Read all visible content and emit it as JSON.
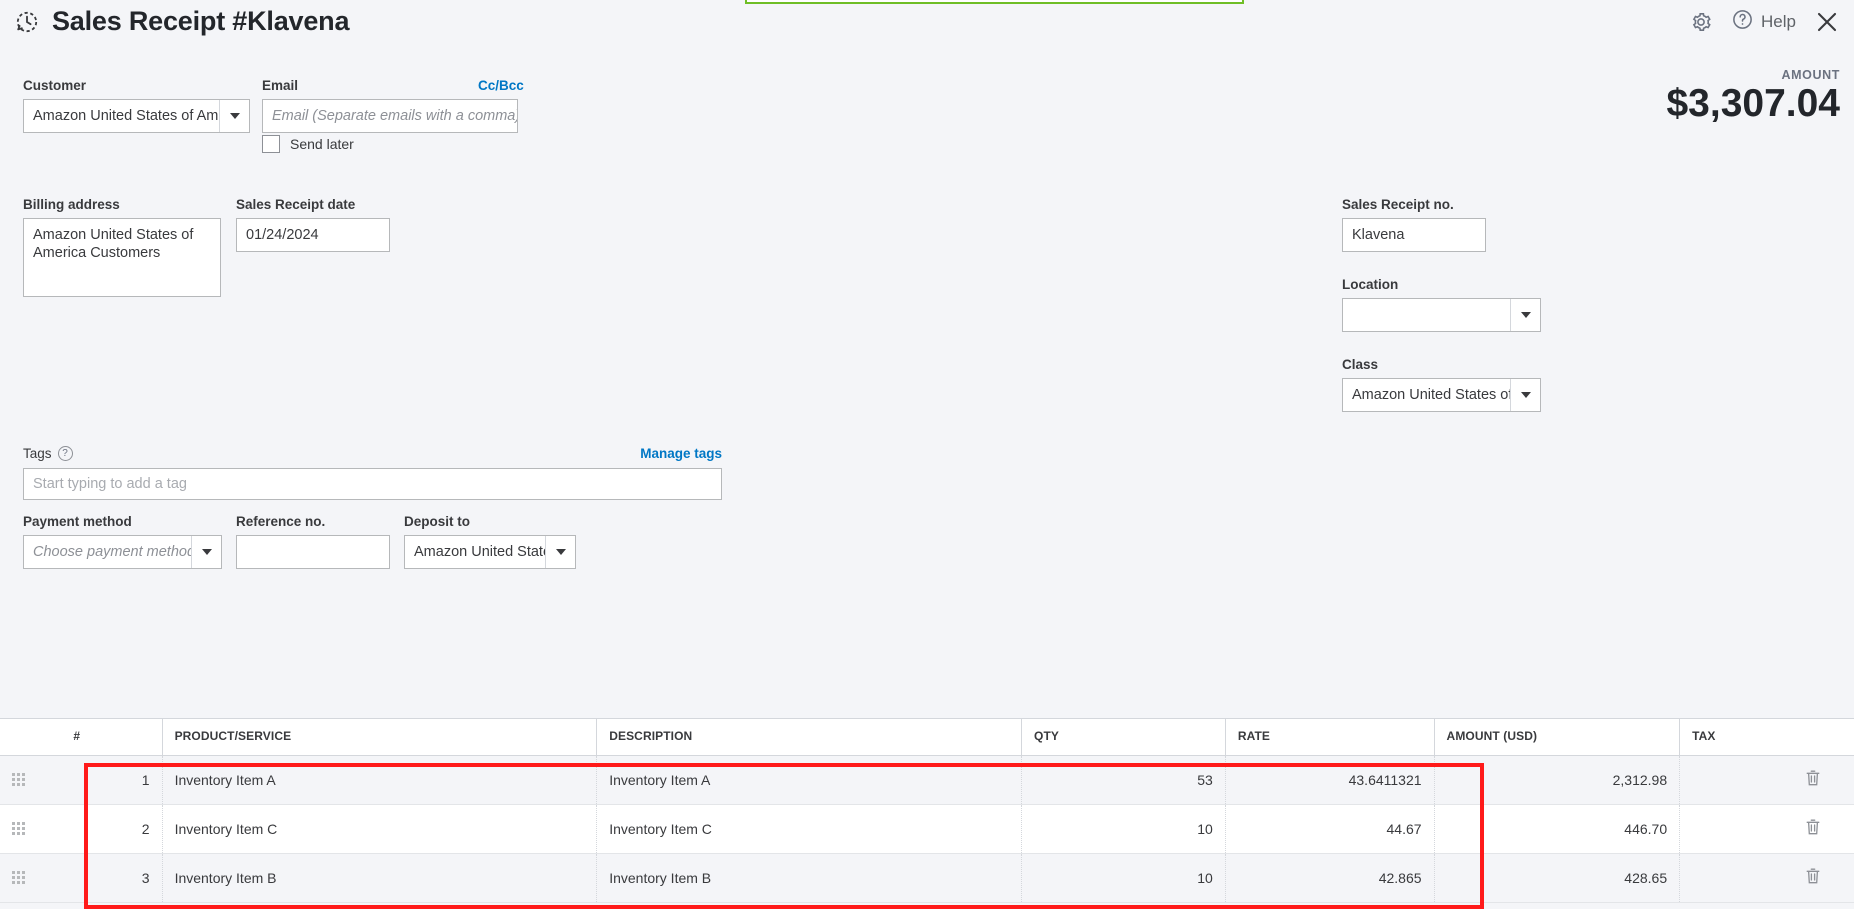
{
  "header": {
    "title": "Sales Receipt #Klavena",
    "recurring_icon": "recurring-clock-icon",
    "gear_icon": "gear-icon",
    "help_icon": "help-circle-icon",
    "help_label": "Help",
    "close_icon": "close-icon"
  },
  "amount": {
    "label": "AMOUNT",
    "value": "$3,307.04"
  },
  "form": {
    "customer": {
      "label": "Customer",
      "value": "Amazon United States of America"
    },
    "email": {
      "label": "Email",
      "cc_bcc": "Cc/Bcc",
      "placeholder": "Email (Separate emails with a comma)",
      "value": ""
    },
    "send_later": {
      "label": "Send later",
      "checked": false
    },
    "billing_address": {
      "label": "Billing address",
      "value": "Amazon United States of America Customers"
    },
    "receipt_date": {
      "label": "Sales Receipt date",
      "value": "01/24/2024"
    },
    "receipt_no": {
      "label": "Sales Receipt no.",
      "value": "Klavena"
    },
    "location": {
      "label": "Location",
      "value": ""
    },
    "class": {
      "label": "Class",
      "value": "Amazon United States of Am"
    },
    "tags": {
      "label": "Tags",
      "help_icon": "question-mark-icon",
      "manage_link": "Manage tags",
      "placeholder": "Start typing to add a tag",
      "value": ""
    },
    "payment_method": {
      "label": "Payment method",
      "placeholder": "Choose payment method",
      "value": ""
    },
    "reference_no": {
      "label": "Reference no.",
      "value": ""
    },
    "deposit_to": {
      "label": "Deposit to",
      "value": "Amazon United States o"
    }
  },
  "line_items": {
    "columns": {
      "handle": "",
      "num": "#",
      "product": "PRODUCT/SERVICE",
      "description": "DESCRIPTION",
      "qty": "QTY",
      "rate": "RATE",
      "amount": "AMOUNT (USD)",
      "tax": "TAX",
      "delete": ""
    },
    "rows": [
      {
        "num": "1",
        "product": "Inventory Item A",
        "description": "Inventory Item A",
        "qty": "53",
        "rate": "43.6411321",
        "amount": "2,312.98",
        "tax": ""
      },
      {
        "num": "2",
        "product": "Inventory Item C",
        "description": "Inventory Item C",
        "qty": "10",
        "rate": "44.67",
        "amount": "446.70",
        "tax": ""
      },
      {
        "num": "3",
        "product": "Inventory Item B",
        "description": "Inventory Item B",
        "qty": "10",
        "rate": "42.865",
        "amount": "428.65",
        "tax": ""
      }
    ],
    "row_icons": {
      "drag": "drag-handle-icon",
      "delete": "trash-icon"
    }
  },
  "colors": {
    "page_bg": "#f4f5f8",
    "link": "#0077c5",
    "highlight_red": "#ff1a1a",
    "banner_green": "#6fbe26",
    "text": "#393a3d"
  }
}
